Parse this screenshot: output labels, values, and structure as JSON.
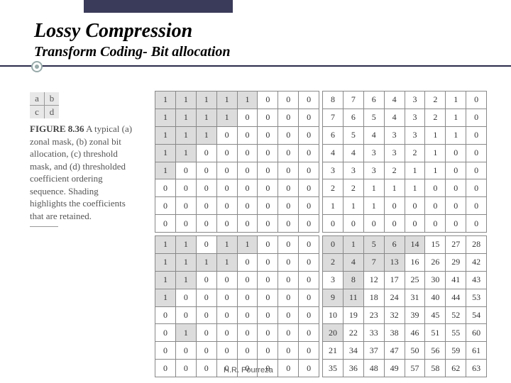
{
  "title": "Lossy Compression",
  "subtitle": "Transform Coding- Bit allocation",
  "abcd": [
    [
      "a",
      "b"
    ],
    [
      "c",
      "d"
    ]
  ],
  "figlabel": "FIGURE 8.36",
  "caption_text": "A typical (a) zonal mask, (b) zonal bit allocation, (c) threshold mask, and (d) thresholded coefficient ordering sequence. Shading highlights the coefficients that are retained.",
  "footer": "H.R. Pourreza",
  "chart_data": [
    {
      "type": "table",
      "title": "(a) zonal mask",
      "rows": 8,
      "cols": 8,
      "shade_values": [
        1
      ],
      "data": [
        [
          1,
          1,
          1,
          1,
          1,
          0,
          0,
          0
        ],
        [
          1,
          1,
          1,
          1,
          0,
          0,
          0,
          0
        ],
        [
          1,
          1,
          1,
          0,
          0,
          0,
          0,
          0
        ],
        [
          1,
          1,
          0,
          0,
          0,
          0,
          0,
          0
        ],
        [
          1,
          0,
          0,
          0,
          0,
          0,
          0,
          0
        ],
        [
          0,
          0,
          0,
          0,
          0,
          0,
          0,
          0
        ],
        [
          0,
          0,
          0,
          0,
          0,
          0,
          0,
          0
        ],
        [
          0,
          0,
          0,
          0,
          0,
          0,
          0,
          0
        ]
      ]
    },
    {
      "type": "table",
      "title": "(b) zonal bit allocation",
      "rows": 8,
      "cols": 8,
      "shade_values": [],
      "data": [
        [
          8,
          7,
          6,
          4,
          3,
          2,
          1,
          0
        ],
        [
          7,
          6,
          5,
          4,
          3,
          2,
          1,
          0
        ],
        [
          6,
          5,
          4,
          3,
          3,
          1,
          1,
          0
        ],
        [
          4,
          4,
          3,
          3,
          2,
          1,
          0,
          0
        ],
        [
          3,
          3,
          3,
          2,
          1,
          1,
          0,
          0
        ],
        [
          2,
          2,
          1,
          1,
          1,
          0,
          0,
          0
        ],
        [
          1,
          1,
          1,
          0,
          0,
          0,
          0,
          0
        ],
        [
          0,
          0,
          0,
          0,
          0,
          0,
          0,
          0
        ]
      ]
    },
    {
      "type": "table",
      "title": "(c) threshold mask",
      "rows": 8,
      "cols": 8,
      "shade_values": [
        1
      ],
      "data": [
        [
          1,
          1,
          0,
          1,
          1,
          0,
          0,
          0
        ],
        [
          1,
          1,
          1,
          1,
          0,
          0,
          0,
          0
        ],
        [
          1,
          1,
          0,
          0,
          0,
          0,
          0,
          0
        ],
        [
          1,
          0,
          0,
          0,
          0,
          0,
          0,
          0
        ],
        [
          0,
          0,
          0,
          0,
          0,
          0,
          0,
          0
        ],
        [
          0,
          1,
          0,
          0,
          0,
          0,
          0,
          0
        ],
        [
          0,
          0,
          0,
          0,
          0,
          0,
          0,
          0
        ],
        [
          0,
          0,
          0,
          0,
          0,
          0,
          0,
          0
        ]
      ]
    },
    {
      "type": "table",
      "title": "(d) thresholded coefficient ordering",
      "rows": 8,
      "cols": 8,
      "shade_values": [
        0,
        1,
        2,
        4,
        5,
        6,
        7,
        8,
        9,
        11,
        13,
        14,
        20
      ],
      "data": [
        [
          0,
          1,
          5,
          6,
          14,
          15,
          27,
          28
        ],
        [
          2,
          4,
          7,
          13,
          16,
          26,
          29,
          42
        ],
        [
          3,
          8,
          12,
          17,
          25,
          30,
          41,
          43
        ],
        [
          9,
          11,
          18,
          24,
          31,
          40,
          44,
          53
        ],
        [
          10,
          19,
          23,
          32,
          39,
          45,
          52,
          54
        ],
        [
          20,
          22,
          33,
          38,
          46,
          51,
          55,
          60
        ],
        [
          21,
          34,
          37,
          47,
          50,
          56,
          59,
          61
        ],
        [
          35,
          36,
          48,
          49,
          57,
          58,
          62,
          63
        ]
      ]
    }
  ]
}
